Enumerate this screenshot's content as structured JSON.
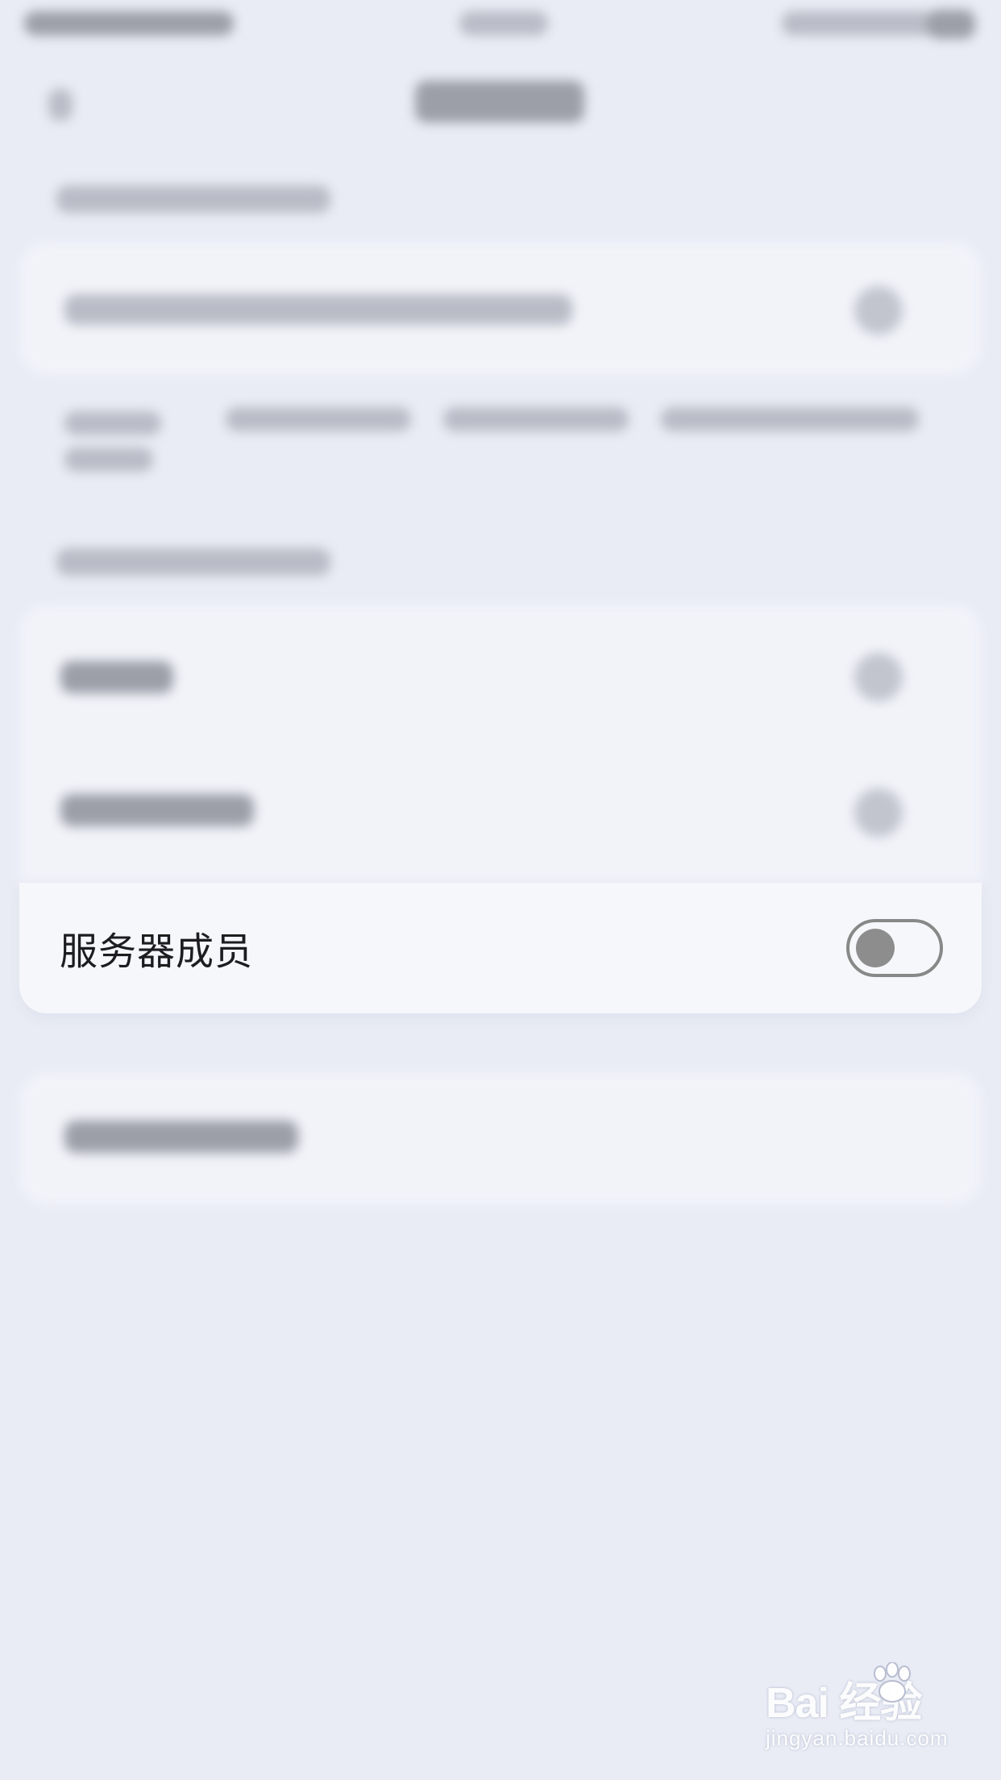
{
  "settings": {
    "member_item": {
      "label": "服务器成员",
      "toggle_on": false
    }
  },
  "watermark": {
    "brand": "Bai  经验",
    "url": "jingyan.baidu.com"
  },
  "colors": {
    "background": "#e9ecf5",
    "card": "#f6f7fb",
    "toggle_border": "#888888",
    "toggle_knob": "#8d8d8d"
  }
}
